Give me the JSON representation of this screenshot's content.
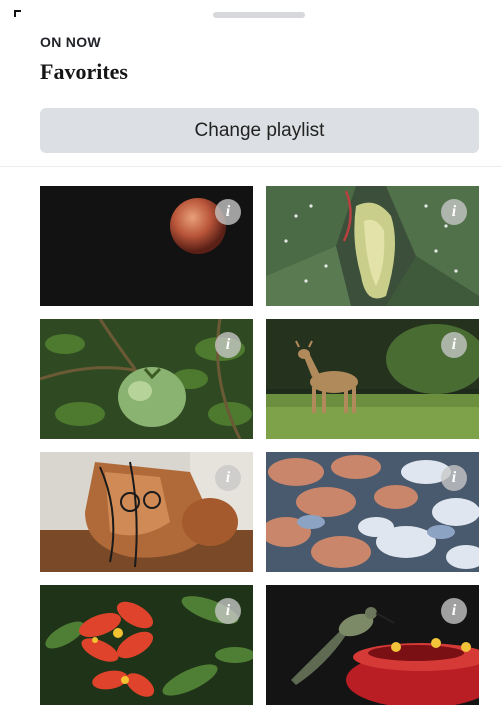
{
  "header": {
    "section_label": "ON NOW",
    "title": "Favorites",
    "change_button_label": "Change playlist"
  },
  "tiles": [
    {
      "subject": "lunar-eclipse-moon",
      "info_icon": "info-icon"
    },
    {
      "subject": "begonia-leaves-bud",
      "info_icon": "info-icon"
    },
    {
      "subject": "green-tomato-plant",
      "info_icon": "info-icon"
    },
    {
      "subject": "deer-in-field",
      "info_icon": "info-icon"
    },
    {
      "subject": "copper-kettle-necklace",
      "info_icon": "info-icon"
    },
    {
      "subject": "pile-of-crabs",
      "info_icon": "info-icon"
    },
    {
      "subject": "red-flowers-leaves",
      "info_icon": "info-icon"
    },
    {
      "subject": "hummingbird-at-feeder",
      "info_icon": "info-icon"
    }
  ],
  "info_glyph": "i",
  "colors": {
    "button_bg": "#dcdfe3",
    "handle": "#d6d8db"
  }
}
